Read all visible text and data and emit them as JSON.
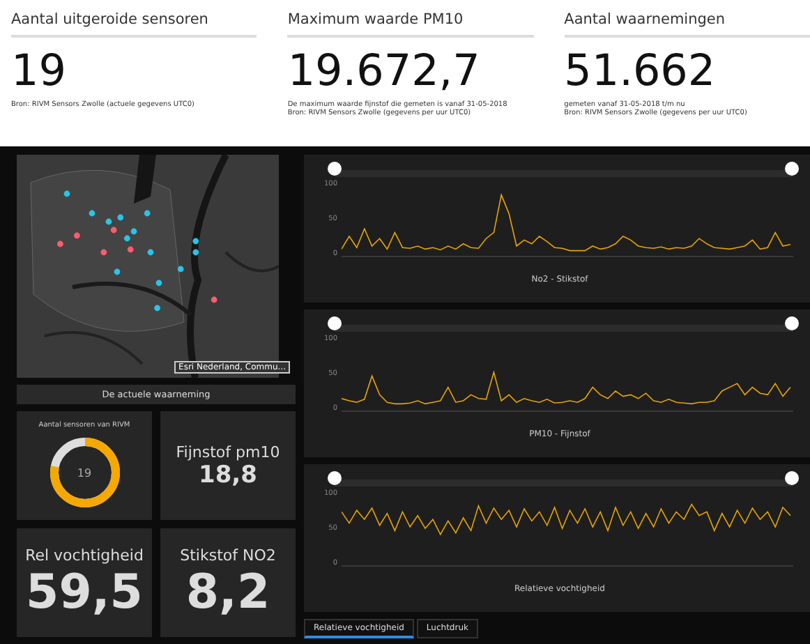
{
  "stats": [
    {
      "title": "Aantal uitgeroide sensoren",
      "value": "19",
      "notes": [
        "Bron: RIVM Sensors Zwolle (actuele gegevens UTC0)"
      ]
    },
    {
      "title": "Maximum waarde PM10",
      "value": "19.672,7",
      "notes": [
        "De maximum waarde fijnstof die gemeten is vanaf 31-05-2018",
        "Bron: RIVM Sensors Zwolle (gegevens per uur UTC0)"
      ]
    },
    {
      "title": "Aantal waarnemingen",
      "value": "51.662",
      "notes": [
        "gemeten vanaf 31-05-2018 t/m nu",
        "Bron: RIVM Sensors Zwolle (gegevens per uur UTC0)"
      ]
    }
  ],
  "map": {
    "kind": "picture",
    "attribution": "Esri Nederland, Commu...",
    "caption": "De actuele waarneming"
  },
  "tiles": [
    {
      "kind": "gauge",
      "title": "Aantal sensoren van RIVM",
      "value": "19",
      "level": 0.78
    },
    {
      "kind": "number",
      "title": "Fijnstof pm10",
      "value": "18,8"
    },
    {
      "kind": "number",
      "title": "Rel vochtigheid",
      "value": "59,5"
    },
    {
      "kind": "number",
      "title": "Stikstof NO2",
      "value": "8,2"
    }
  ],
  "charts": [
    {
      "chart_data": {
        "type": "line",
        "title": "No2 - Stikstof",
        "ylim": [
          0,
          100
        ],
        "yticks": [
          0,
          50,
          100
        ],
        "values": [
          8,
          25,
          10,
          35,
          12,
          22,
          8,
          30,
          10,
          9,
          12,
          8,
          10,
          7,
          12,
          8,
          15,
          10,
          9,
          22,
          30,
          80,
          55,
          12,
          20,
          15,
          25,
          18,
          10,
          9,
          6,
          6,
          6,
          12,
          8,
          10,
          15,
          25,
          20,
          12,
          10,
          9,
          11,
          8,
          10,
          9,
          12,
          22,
          15,
          10,
          9,
          8,
          10,
          12,
          20,
          8,
          10,
          30,
          12,
          14
        ]
      }
    },
    {
      "chart_data": {
        "type": "line",
        "title": "PM10 - Fijnstof",
        "ylim": [
          0,
          100
        ],
        "yticks": [
          0,
          50,
          100
        ],
        "values": [
          15,
          12,
          10,
          14,
          45,
          20,
          10,
          8,
          8,
          9,
          12,
          8,
          10,
          12,
          30,
          10,
          12,
          20,
          15,
          14,
          50,
          12,
          20,
          10,
          15,
          12,
          10,
          14,
          9,
          10,
          12,
          10,
          15,
          30,
          20,
          15,
          25,
          18,
          20,
          15,
          22,
          12,
          10,
          14,
          10,
          9,
          8,
          10,
          10,
          12,
          25,
          30,
          35,
          20,
          30,
          22,
          20,
          35,
          18,
          30
        ]
      }
    },
    {
      "chart_data": {
        "type": "line",
        "title": "Relatieve vochtigheid",
        "ylim": [
          0,
          100
        ],
        "yticks": [
          0,
          50,
          100
        ],
        "values": [
          70,
          55,
          72,
          60,
          75,
          52,
          68,
          45,
          70,
          50,
          65,
          48,
          60,
          40,
          58,
          42,
          62,
          45,
          78,
          55,
          75,
          60,
          72,
          50,
          74,
          58,
          70,
          52,
          76,
          48,
          72,
          55,
          74,
          50,
          70,
          45,
          76,
          52,
          70,
          48,
          68,
          50,
          74,
          55,
          70,
          60,
          80,
          65,
          70,
          45,
          68,
          50,
          72,
          55,
          75,
          60,
          70,
          50,
          76,
          65
        ]
      }
    }
  ],
  "tabs": [
    {
      "label": "Relatieve vochtigheid",
      "selected": true
    },
    {
      "label": "Luchtdruk",
      "selected": false
    }
  ]
}
